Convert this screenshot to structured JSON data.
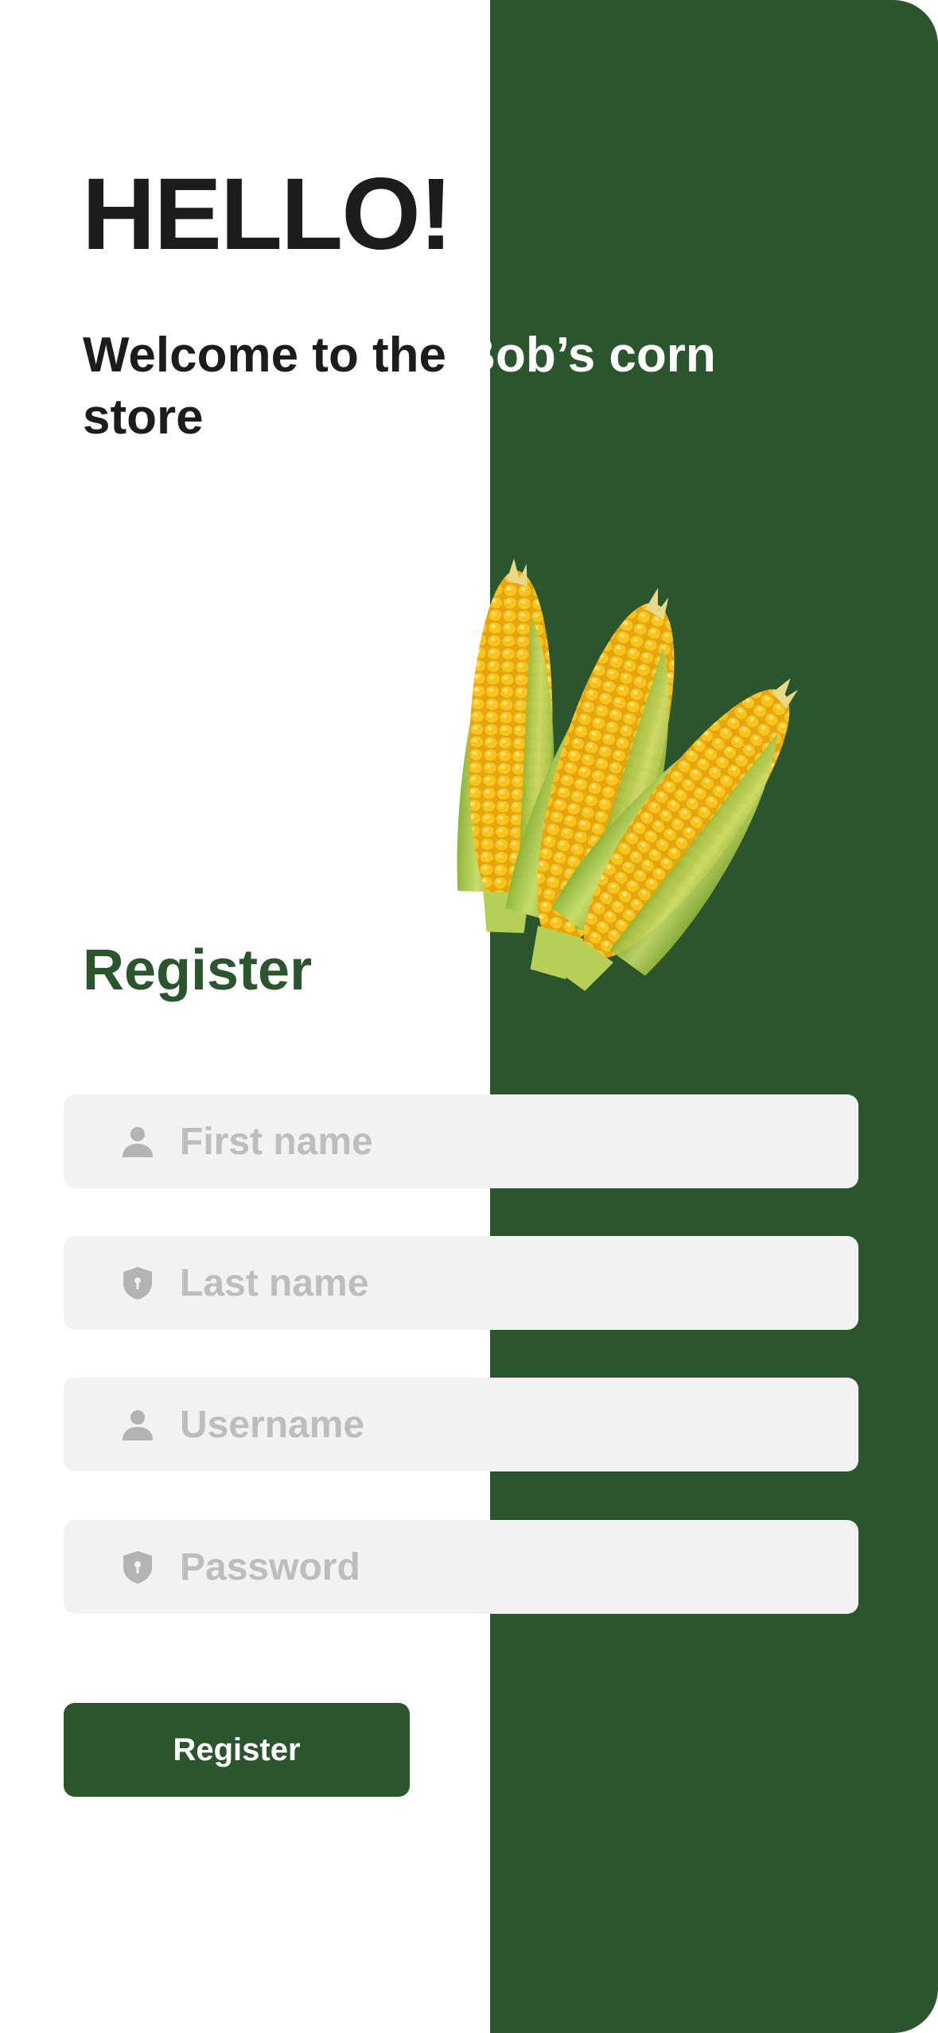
{
  "hero": {
    "title": "HELLO!",
    "welcome_prefix": "Welcome  to the ",
    "welcome_highlight": "Bob’s corn",
    "welcome_suffix": "store"
  },
  "register": {
    "title": "Register",
    "fields": [
      {
        "placeholder": "First name",
        "icon": "user-icon"
      },
      {
        "placeholder": "Last name",
        "icon": "shield-icon"
      },
      {
        "placeholder": "Username",
        "icon": "user-icon"
      },
      {
        "placeholder": "Password",
        "icon": "shield-icon"
      }
    ],
    "button_label": "Register"
  },
  "colors": {
    "brand_green": "#2b552c",
    "field_bg": "#f2f2f2",
    "placeholder": "#bdbdbd",
    "text_dark": "#1c1c1c",
    "corn_yellow": "#f5bf1a",
    "husk_green": "#a9c94a"
  }
}
